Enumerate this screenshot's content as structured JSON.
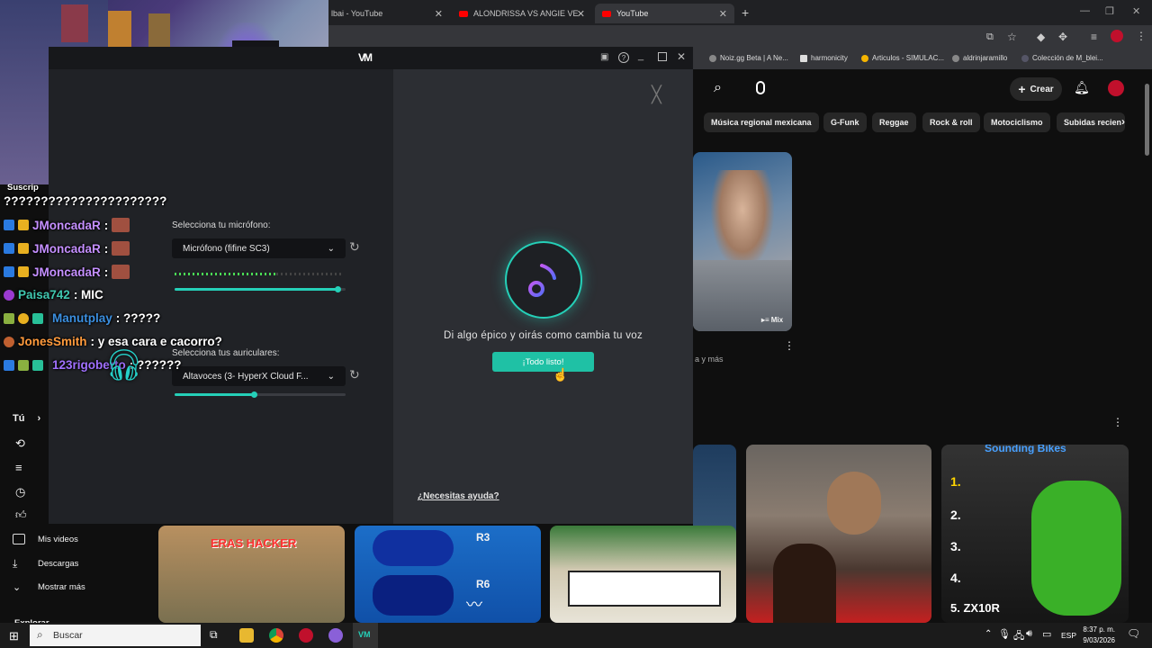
{
  "browser": {
    "tabs": [
      {
        "label": "lbai - YouTube"
      },
      {
        "label": "ALONDRISSA VS ANGIE VELASC"
      },
      {
        "label": "YouTube"
      }
    ],
    "new_tab": "+",
    "bookmarks": [
      {
        "label": "Noiz.gg Beta | A Ne..."
      },
      {
        "label": "harmonicity"
      },
      {
        "label": "Articulos - SIMULAC..."
      },
      {
        "label": "aldrinjaramillo"
      },
      {
        "label": "Colección de M_blei..."
      }
    ]
  },
  "youtube": {
    "create_label": "Crear",
    "chips": [
      "Música regional mexicana",
      "G-Funk",
      "Reggae",
      "Rock & roll",
      "Motociclismo",
      "Subidas recien"
    ],
    "mix_badge": "Mix",
    "partial_text": "a y más",
    "sidebar": {
      "you_label": "Tú",
      "items": [
        "Mis videos",
        "Descargas",
        "Mostrar más"
      ],
      "explore": "Explorar"
    },
    "thumb_texts": {
      "eras_hacker": "ERAS HACKER",
      "r3": "R3",
      "r6": "R6",
      "sounding_bikes": "Sounding Bikes",
      "zx10r": "5. ZX10R",
      "n1": "1.",
      "n2": "2.",
      "n3": "3.",
      "n4": "4."
    }
  },
  "chat": {
    "suscrip": "Suscrip",
    "lines": [
      {
        "user": "",
        "msg": "??????????????????????",
        "color": "#ffffff"
      },
      {
        "user": "JMoncadaR",
        "msg": ":",
        "color": "#c48fff"
      },
      {
        "user": "JMoncadaR",
        "msg": ":",
        "color": "#c48fff"
      },
      {
        "user": "JMoncadaR",
        "msg": ":",
        "color": "#c48fff"
      },
      {
        "user": "Paisa742",
        "msg": ": MIC",
        "color": "#40c8b0"
      },
      {
        "user": "Manutplay",
        "msg": ": ?????",
        "color": "#3b8fe0"
      },
      {
        "user": "JonesSmith",
        "msg": ": y esa cara e cacorro?",
        "color": "#ff9a3c"
      },
      {
        "user": "123rigoberto",
        "msg": ": ??????",
        "color": "#a070ff"
      }
    ]
  },
  "voicemod": {
    "mic_label": "Selecciona tu micrófono:",
    "mic_value": "Micrófono (fifine SC3)",
    "mic_level": 0.96,
    "headphones_label": "Selecciona tus auriculares:",
    "headphones_value": "Altavoces (3- HyperX Cloud F...",
    "headphones_level": 0.47,
    "prompt": "Di algo épico y oirás como cambia tu voz",
    "ready_button": "¡Todo listo!",
    "help_link": "¿Necesitas ayuda?",
    "accent": "#1fc1a5"
  },
  "taskbar": {
    "search_placeholder": "Buscar",
    "lang": "ESP",
    "time": "8:37 p. m.",
    "date": "9/03/2026"
  }
}
